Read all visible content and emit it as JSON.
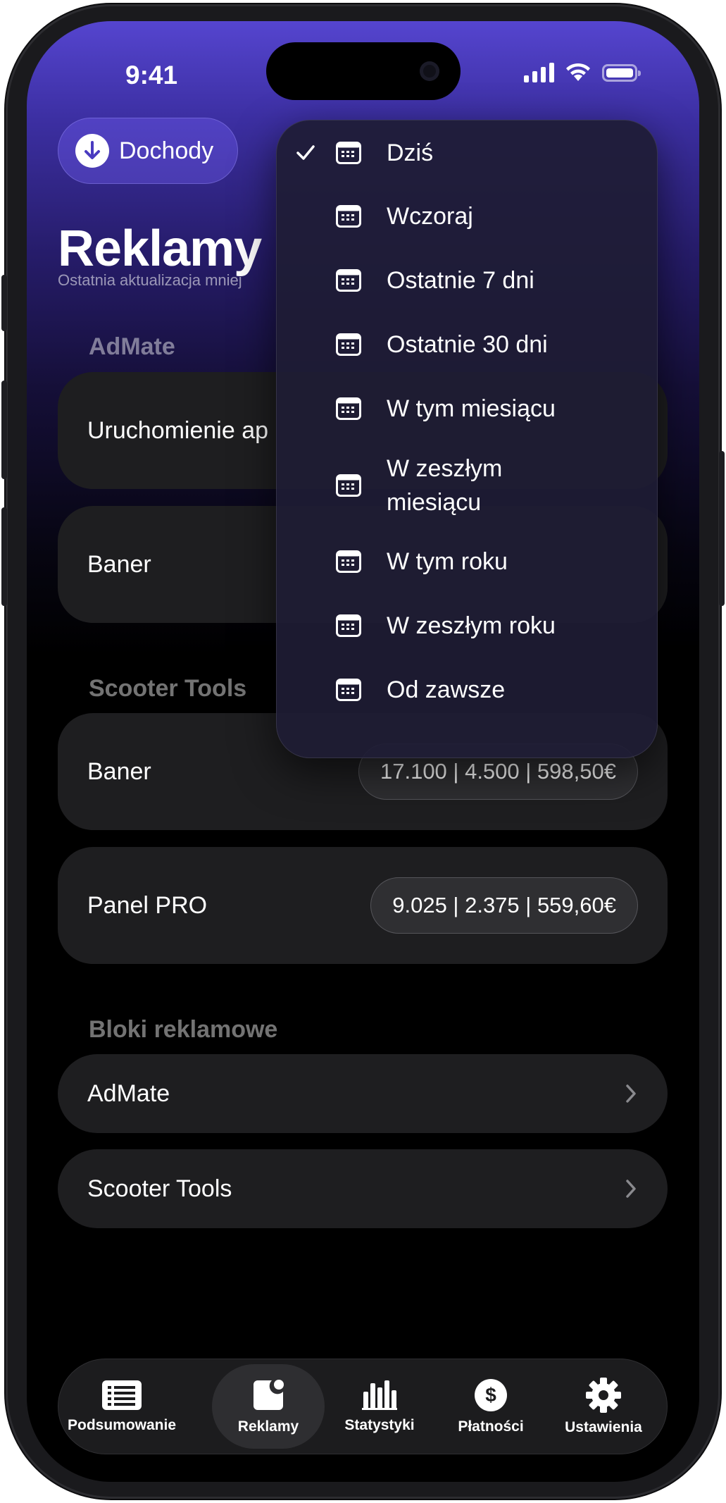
{
  "status_bar": {
    "time": "9:41"
  },
  "header": {
    "income_button": "Dochody",
    "title": "Reklamy",
    "subtitle": "Ostatnia aktualizacja mniej"
  },
  "sections": {
    "admate_heading": "AdMate",
    "admate_rows": [
      "Uruchomienie ap",
      "Baner"
    ],
    "scooter_heading": "Scooter Tools",
    "scooter_rows": [
      {
        "label": "Baner",
        "value": "17.100 | 4.500 | 598,50€"
      },
      {
        "label": "Panel PRO",
        "value": "9.025 | 2.375 | 559,60€"
      }
    ],
    "blocks_heading": "Bloki reklamowe",
    "blocks": [
      "AdMate",
      "Scooter Tools"
    ]
  },
  "dropdown": {
    "items": [
      "Dziś",
      "Wczoraj",
      "Ostatnie 7 dni",
      "Ostatnie 30 dni",
      "W tym miesiącu",
      "W zeszłym miesiącu",
      "W tym roku",
      "W zeszłym roku",
      "Od zawsze"
    ],
    "selected_index": 0
  },
  "tabbar": {
    "tabs": [
      "Podsumowanie",
      "Reklamy",
      "Statystyki",
      "Płatności",
      "Ustawienia"
    ],
    "active_index": 1
  },
  "colors": {
    "accent_top": "#5545cf",
    "card_bg": "#1e1e20",
    "pill_bg": "#2f2f32"
  }
}
